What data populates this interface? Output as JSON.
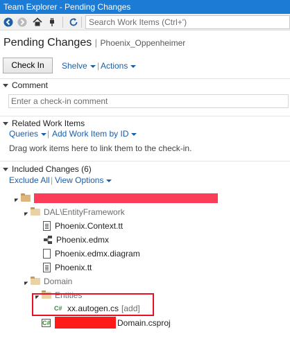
{
  "window": {
    "title": "Team Explorer - Pending Changes"
  },
  "toolbar": {
    "back_icon": "back-arrow-icon",
    "forward_icon": "forward-arrow-icon",
    "home_icon": "home-icon",
    "connect_icon": "plug-icon",
    "refresh_icon": "refresh-icon",
    "search_placeholder": "Search Work Items (Ctrl+')"
  },
  "header": {
    "title": "Pending Changes",
    "separator": "|",
    "workspace": "Phoenix_Oppenheimer"
  },
  "actions": {
    "checkin_label": "Check In",
    "shelve_label": "Shelve",
    "actions_label": "Actions",
    "separator": "|"
  },
  "comment": {
    "heading": "Comment",
    "placeholder": "Enter a check-in comment"
  },
  "related": {
    "heading": "Related Work Items",
    "queries_label": "Queries",
    "add_label": "Add Work Item by ID",
    "separator": "|",
    "hint": "Drag work items here to link them to the check-in."
  },
  "included": {
    "heading": "Included Changes (6)",
    "exclude_all": "Exclude All",
    "view_options": "View Options",
    "separator": "|",
    "tree": {
      "dal_folder": "DAL\\EntityFramework",
      "files": {
        "context": "Phoenix.Context.tt",
        "edmx": "Phoenix.edmx",
        "diagram": "Phoenix.edmx.diagram",
        "tt": "Phoenix.tt"
      },
      "domain_folder": "Domain",
      "entities_folder": "Entities",
      "autogen_file": "xx.autogen.cs",
      "autogen_status": "[add]",
      "csproj_suffix": "Domain.csproj"
    }
  },
  "colors": {
    "accent": "#1c7bd4",
    "link": "#1a5ea8",
    "redaction": "#fc3d59",
    "highlight": "#e81123"
  }
}
